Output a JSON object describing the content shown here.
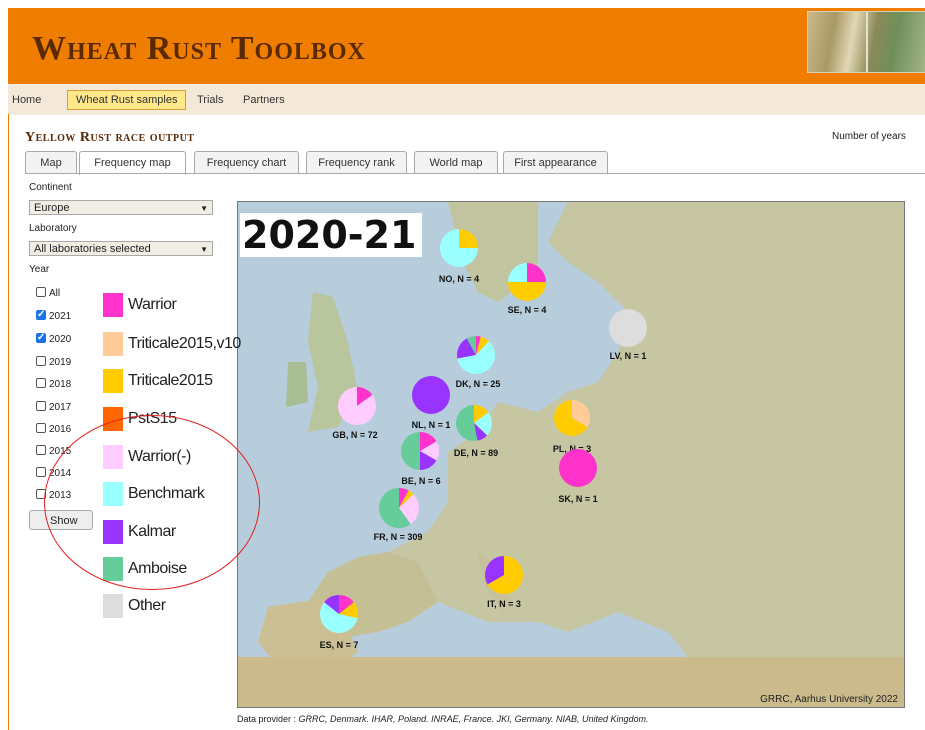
{
  "header": {
    "title": "Wheat Rust Toolbox"
  },
  "nav": [
    {
      "label": "Home",
      "active": false
    },
    {
      "label": "Wheat Rust samples",
      "active": true
    },
    {
      "label": "Trials",
      "active": false
    },
    {
      "label": "Partners",
      "active": false
    }
  ],
  "page_title": "Yellow Rust race output",
  "number_of_years_label": "Number of years",
  "tabs": [
    "Map",
    "Frequency map",
    "Frequency chart",
    "Frequency rank",
    "World map",
    "First appearance"
  ],
  "active_tab": "Frequency map",
  "filters": {
    "continent_label": "Continent",
    "continent_value": "Europe",
    "laboratory_label": "Laboratory",
    "laboratory_value": "All laboratories selected",
    "year_label": "Year",
    "years": [
      {
        "label": "All",
        "checked": false
      },
      {
        "label": "2021",
        "checked": true
      },
      {
        "label": "2020",
        "checked": true
      },
      {
        "label": "2019",
        "checked": false
      },
      {
        "label": "2018",
        "checked": false
      },
      {
        "label": "2017",
        "checked": false
      },
      {
        "label": "2016",
        "checked": false
      },
      {
        "label": "2015",
        "checked": false
      },
      {
        "label": "2014",
        "checked": false
      },
      {
        "label": "2013",
        "checked": false
      }
    ],
    "show_label": "Show"
  },
  "legend": [
    {
      "label": "Warrior",
      "color": "#ff33cc"
    },
    {
      "label": "Triticale2015,v10",
      "color": "#ffcc99"
    },
    {
      "label": "Triticale2015",
      "color": "#ffcc00"
    },
    {
      "label": "PstS15",
      "color": "#ff6600"
    },
    {
      "label": "Warrior(-)",
      "color": "#ffccff"
    },
    {
      "label": "Benchmark",
      "color": "#99ffff"
    },
    {
      "label": "Kalmar",
      "color": "#9933ff"
    },
    {
      "label": "Amboise",
      "color": "#66cc99"
    },
    {
      "label": "Other",
      "color": "#dddddd"
    }
  ],
  "season": "2020-21",
  "map_credit": "GRRC, Aarhus University 2022",
  "data_provider_label": "Data provider :",
  "data_provider_text": "GRRC, Denmark. IHAR, Poland. INRAE, France. JKI, Germany. NIAB, United Kingdom.",
  "pies": [
    {
      "label": "NO, N = 4",
      "slices": [
        {
          "race": "Triticale2015",
          "value": 0.25
        },
        {
          "race": "Benchmark",
          "value": 0.75
        }
      ]
    },
    {
      "label": "SE, N = 4",
      "slices": [
        {
          "race": "Warrior",
          "value": 0.25
        },
        {
          "race": "Triticale2015",
          "value": 0.5
        },
        {
          "race": "Benchmark",
          "value": 0.25
        }
      ]
    },
    {
      "label": "LV, N = 1",
      "slices": [
        {
          "race": "Other",
          "value": 1
        }
      ]
    },
    {
      "label": "DK, N = 25",
      "slices": [
        {
          "race": "Warrior",
          "value": 0.04
        },
        {
          "race": "Triticale2015",
          "value": 0.08
        },
        {
          "race": "Benchmark",
          "value": 0.6
        },
        {
          "race": "Kalmar",
          "value": 0.2
        },
        {
          "race": "Amboise",
          "value": 0.08
        }
      ]
    },
    {
      "label": "GB, N = 72",
      "slices": [
        {
          "race": "Warrior",
          "value": 0.15
        },
        {
          "race": "Warrior(-)",
          "value": 0.85
        }
      ]
    },
    {
      "label": "NL, N = 1",
      "slices": [
        {
          "race": "Kalmar",
          "value": 1
        }
      ]
    },
    {
      "label": "DE, N = 89",
      "slices": [
        {
          "race": "Triticale2015",
          "value": 0.15
        },
        {
          "race": "Benchmark",
          "value": 0.22
        },
        {
          "race": "Kalmar",
          "value": 0.1
        },
        {
          "race": "Amboise",
          "value": 0.53
        }
      ]
    },
    {
      "label": "PL, N = 3",
      "slices": [
        {
          "race": "Triticale2015,v10",
          "value": 0.333
        },
        {
          "race": "Triticale2015",
          "value": 0.667
        }
      ]
    },
    {
      "label": "BE, N = 6",
      "slices": [
        {
          "race": "Warrior",
          "value": 0.167
        },
        {
          "race": "Warrior(-)",
          "value": 0.167
        },
        {
          "race": "Kalmar",
          "value": 0.167
        },
        {
          "race": "Amboise",
          "value": 0.5
        }
      ]
    },
    {
      "label": "SK, N = 1",
      "slices": [
        {
          "race": "Warrior",
          "value": 1
        }
      ]
    },
    {
      "label": "FR, N = 309",
      "slices": [
        {
          "race": "Warrior",
          "value": 0.08
        },
        {
          "race": "Triticale2015",
          "value": 0.05
        },
        {
          "race": "Warrior(-)",
          "value": 0.27
        },
        {
          "race": "Amboise",
          "value": 0.6
        }
      ]
    },
    {
      "label": "IT, N = 3",
      "slices": [
        {
          "race": "Triticale2015",
          "value": 0.667
        },
        {
          "race": "Kalmar",
          "value": 0.333
        }
      ]
    },
    {
      "label": "ES, N = 7",
      "slices": [
        {
          "race": "Warrior",
          "value": 0.143
        },
        {
          "race": "Triticale2015",
          "value": 0.143
        },
        {
          "race": "Benchmark",
          "value": 0.571
        },
        {
          "race": "Kalmar",
          "value": 0.143
        }
      ]
    }
  ]
}
